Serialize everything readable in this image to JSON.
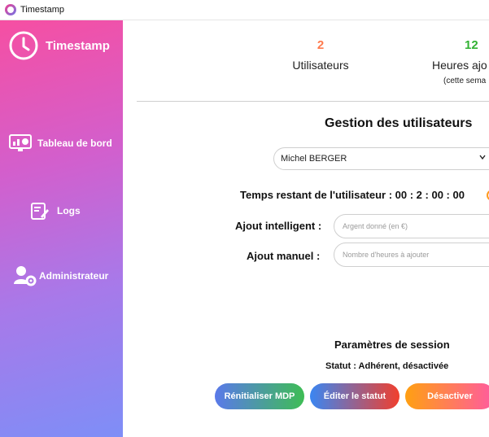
{
  "window": {
    "title": "Timestamp"
  },
  "sidebar": {
    "brand": "Timestamp",
    "items": [
      {
        "label": "Tableau de bord",
        "icon": "dashboard-icon"
      },
      {
        "label": "Logs",
        "icon": "logs-edit-icon"
      },
      {
        "label": "Administrateur",
        "icon": "admin-gear-icon"
      }
    ]
  },
  "stats": {
    "users": {
      "value": "2",
      "label": "Utilisateurs",
      "color": "#ff7a4d"
    },
    "hours": {
      "value": "12",
      "label": "Heures ajo",
      "sub": "(cette sema",
      "color": "#32b233"
    }
  },
  "management": {
    "title": "Gestion des utilisateurs",
    "selected_user": "Michel BERGER",
    "remaining_time_label": "Temps restant de l'utilisateur : 00 : 2 : 00 : 00",
    "smart_add_label": "Ajout intelligent :",
    "smart_add_placeholder": "Argent donné (en €)",
    "manual_add_label": "Ajout manuel :",
    "manual_add_placeholder": "Nombre d'heures à ajouter"
  },
  "session": {
    "title": "Paramètres de session",
    "status": "Statut : Adhérent, désactivée",
    "buttons": {
      "reset": "Rénitialiser MDP",
      "edit": "Éditer le statut",
      "deactivate": "Désactiver"
    }
  }
}
